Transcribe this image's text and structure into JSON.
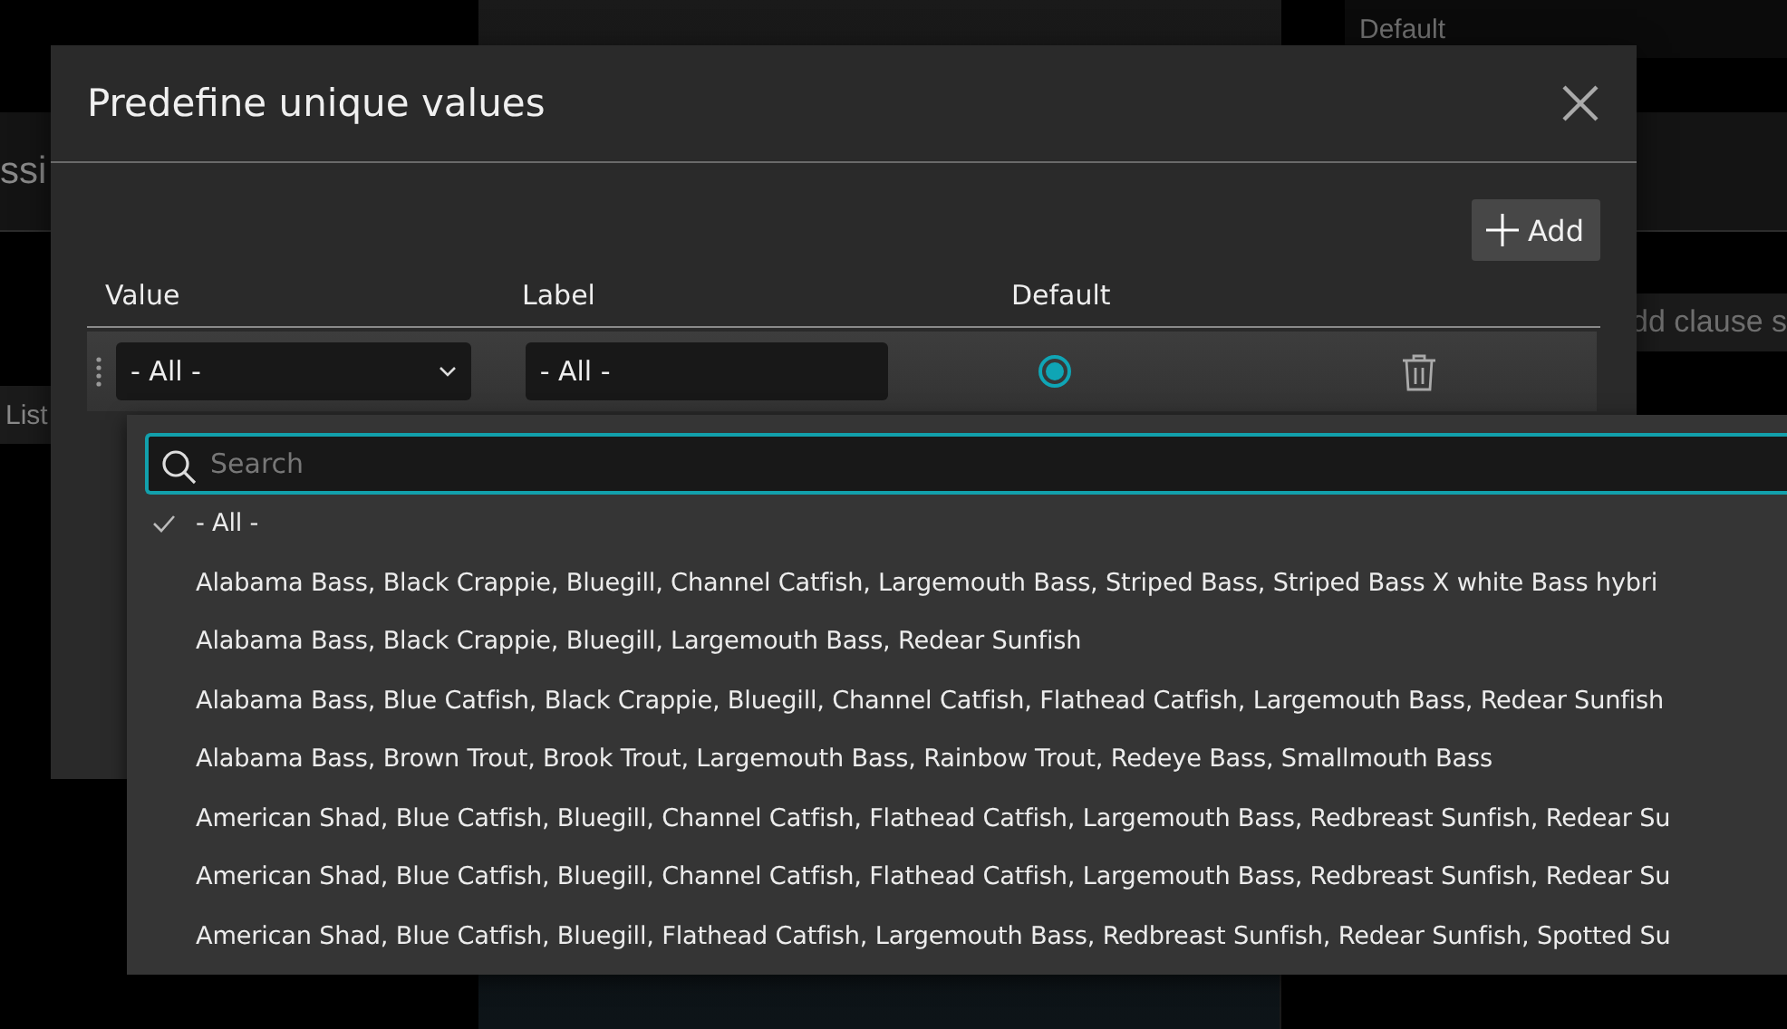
{
  "background": {
    "left_panel": {
      "heading": "ssi",
      "tab": "List"
    },
    "right_panel": {
      "label": "Default",
      "hint": "dd clause s"
    }
  },
  "dialog": {
    "title": "Predefine unique values",
    "add_button": {
      "label": "Add"
    },
    "columns": [
      "Value",
      "Label",
      "Default"
    ],
    "rows": [
      {
        "value": "- All -",
        "label": "- All -",
        "default": true,
        "expanded": true
      }
    ],
    "dropdown": {
      "search": {
        "placeholder": "Search"
      },
      "options": [
        {
          "text": "- All -",
          "selected": true
        },
        {
          "text": "Alabama Bass, Black Crappie, Bluegill, Channel Catfish, Largemouth Bass, Striped Bass, Striped Bass X white Bass hybri",
          "selected": false
        },
        {
          "text": "Alabama Bass, Black Crappie, Bluegill, Largemouth Bass, Redear Sunfish",
          "selected": false
        },
        {
          "text": "Alabama Bass, Blue Catfish, Black Crappie, Bluegill, Channel Catfish, Flathead Catfish, Largemouth Bass, Redear Sunfish",
          "selected": false
        },
        {
          "text": "Alabama Bass, Brown Trout, Brook Trout, Largemouth Bass, Rainbow Trout, Redeye Bass, Smallmouth Bass",
          "selected": false
        },
        {
          "text": "American Shad, Blue Catfish, Bluegill, Channel Catfish, Flathead Catfish, Largemouth Bass, Redbreast Sunfish, Redear Su",
          "selected": false
        },
        {
          "text": "American Shad, Blue Catfish, Bluegill, Channel Catfish, Flathead Catfish, Largemouth Bass, Redbreast Sunfish, Redear Su",
          "selected": false
        },
        {
          "text": "American Shad, Blue Catfish, Bluegill, Flathead Catfish, Largemouth Bass, Redbreast Sunfish, Redear Sunfish, Spotted Su",
          "selected": false
        }
      ]
    }
  }
}
